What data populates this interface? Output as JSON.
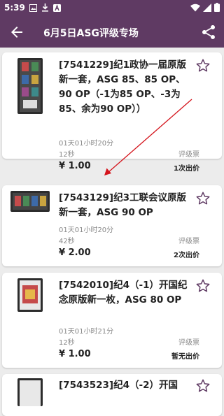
{
  "status_bar": {
    "time": "5:39",
    "left_icons": [
      "image-icon",
      "download-icon",
      "a-icon"
    ],
    "right_icons": [
      "wifi-icon",
      "cellular-icon",
      "battery-icon"
    ]
  },
  "app_bar": {
    "title": "6月5日ASG评级专场",
    "back_icon": "arrow-back-icon",
    "share_icon": "share-icon"
  },
  "colors": {
    "primary": "#5f3a63",
    "annotation_arrow": "#d4141c",
    "star": "#5f3a63"
  },
  "lots": [
    {
      "title": "[7541229]纪1政协一届原版新一套，ASG 85、85 OP、90 OP（-1为85 OP、-3为85、余为90 OP））",
      "time_line1": "01天01小时20分",
      "time_line2": "12秒",
      "grade_label": "评级票",
      "price": "¥ 1.00",
      "bid_status": "1次出价"
    },
    {
      "title": "[7543129]纪3工联会议原版新一套，ASG 90 OP",
      "time_line1": "01天01小时20分",
      "time_line2": "42秒",
      "grade_label": "评级票",
      "price": "¥ 2.00",
      "bid_status": "2次出价"
    },
    {
      "title": "[7542010]纪4（-1）开国纪念原版新一枚，ASG 80 OP",
      "time_line1": "01天01小时21分",
      "time_line2": "12秒",
      "grade_label": "评级票",
      "price": "¥ 1.00",
      "bid_status": "暂无出价"
    },
    {
      "title": "[7543523]纪4（-2）开国"
    }
  ]
}
